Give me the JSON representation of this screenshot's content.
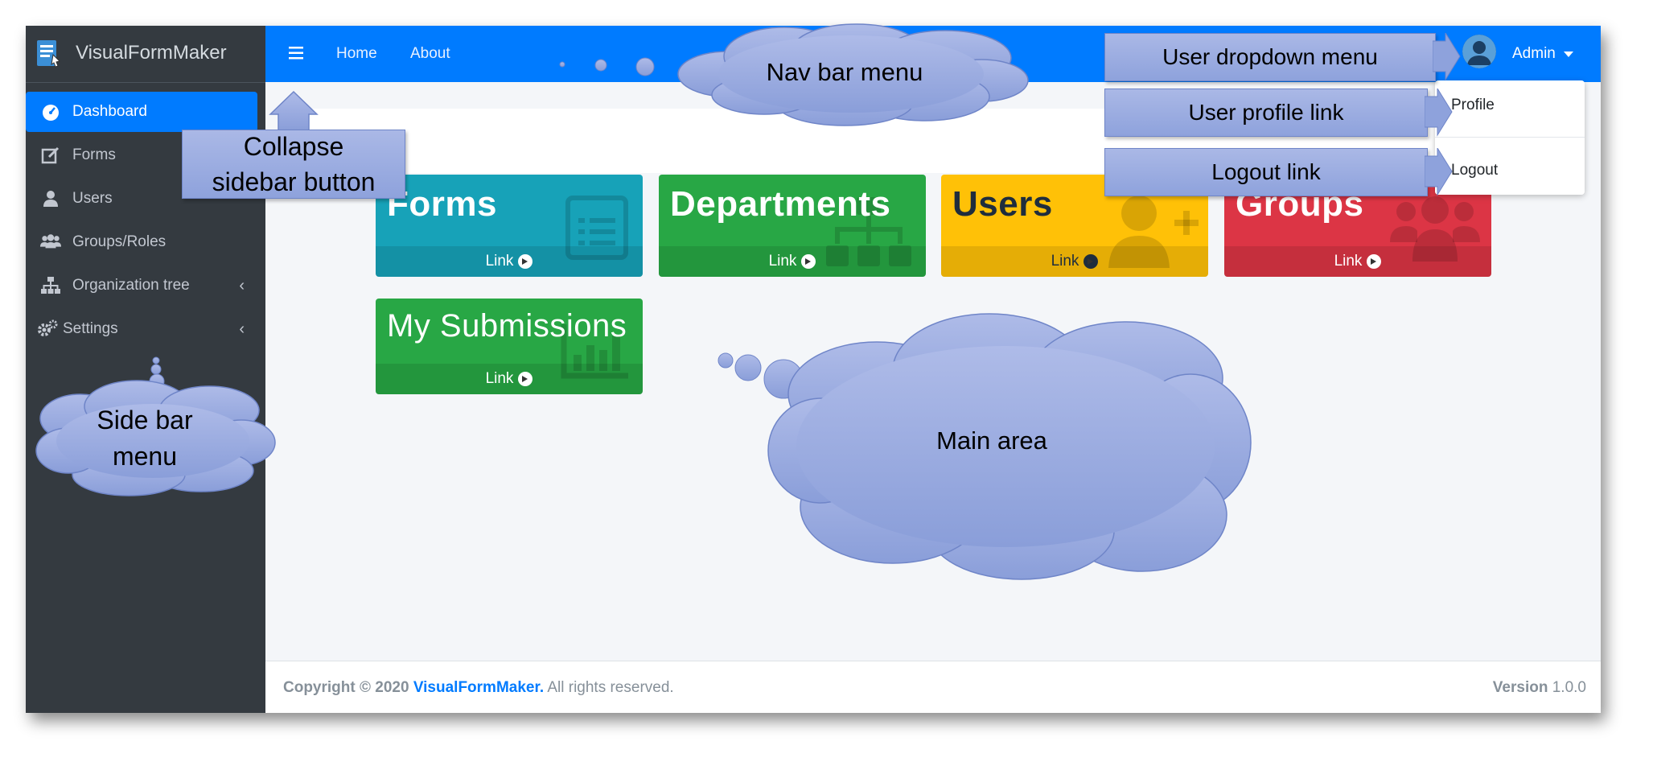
{
  "brand": {
    "name": "VisualFormMaker"
  },
  "sidebar": {
    "items": [
      {
        "label": "Dashboard",
        "icon": "dashboard-icon",
        "active": true
      },
      {
        "label": "Forms",
        "icon": "edit-icon"
      },
      {
        "label": "Users",
        "icon": "user-icon"
      },
      {
        "label": "Groups/Roles",
        "icon": "users-icon"
      },
      {
        "label": "Organization tree",
        "icon": "sitemap-icon",
        "chevron": "‹"
      },
      {
        "label": "Settings",
        "icon": "cogs-icon",
        "chevron": "‹"
      }
    ]
  },
  "topnav": {
    "menu_icon": "≡",
    "home_label": "Home",
    "about_label": "About",
    "user_label": "Admin"
  },
  "dropdown": {
    "profile_label": "Profile",
    "logout_label": "Logout"
  },
  "cards": [
    {
      "title": "Forms",
      "link": "Link",
      "color": "#17a2b8"
    },
    {
      "title": "Departments",
      "link": "Link",
      "color": "#28a745"
    },
    {
      "title": "Users",
      "link": "Link",
      "color": "#ffc107"
    },
    {
      "title": "Groups",
      "link": "Link",
      "color": "#dc3545"
    },
    {
      "title": "My Submissions",
      "link": "Link",
      "color": "#28a745"
    }
  ],
  "footer": {
    "copyright_prefix": "Copyright © 2020",
    "brand_link": "VisualFormMaker.",
    "rights": "All rights reserved.",
    "version_label": "Version",
    "version_value": "1.0.0"
  },
  "annotations": {
    "nav_bar_menu": "Nav bar menu",
    "user_dropdown_menu": "User dropdown menu",
    "user_profile_link": "User profile link",
    "logout_link": "Logout link",
    "collapse_line1": "Collapse",
    "collapse_line2": "sidebar button",
    "side_bar_line1": "Side bar",
    "side_bar_line2": "menu",
    "main_area": "Main area"
  },
  "colors": {
    "primary": "#007bff",
    "sidebar": "#343a40",
    "callout": "#8ea2dc"
  }
}
